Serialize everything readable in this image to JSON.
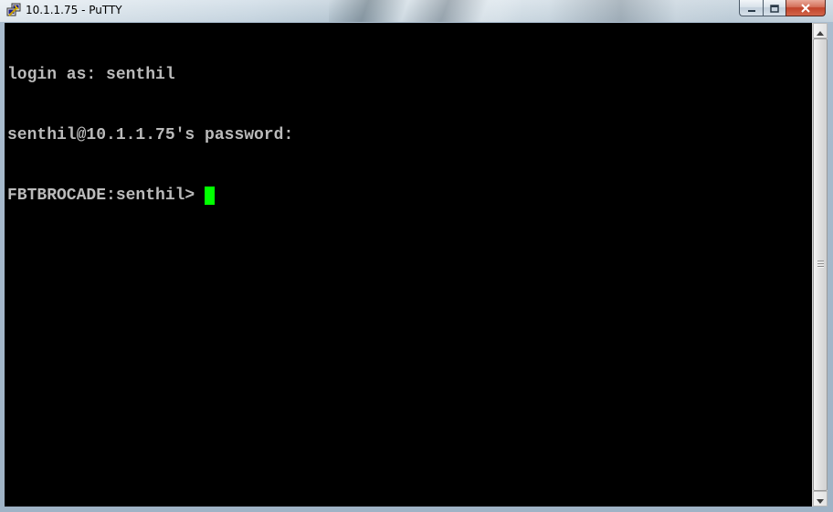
{
  "window": {
    "title": "10.1.1.75 - PuTTY",
    "app_icon": "putty-icon"
  },
  "caption_buttons": {
    "minimize_icon": "minimize-icon",
    "maximize_icon": "maximize-icon",
    "close_icon": "close-icon"
  },
  "terminal": {
    "lines": [
      "login as: senthil",
      "senthil@10.1.1.75's password:",
      "FBTBROCADE:senthil> "
    ],
    "cursor_color": "#00ff00",
    "text_color": "#bbbbbb",
    "background_color": "#000000"
  },
  "scrollbar": {
    "up_icon": "scroll-up-arrow-icon",
    "down_icon": "scroll-down-arrow-icon"
  }
}
